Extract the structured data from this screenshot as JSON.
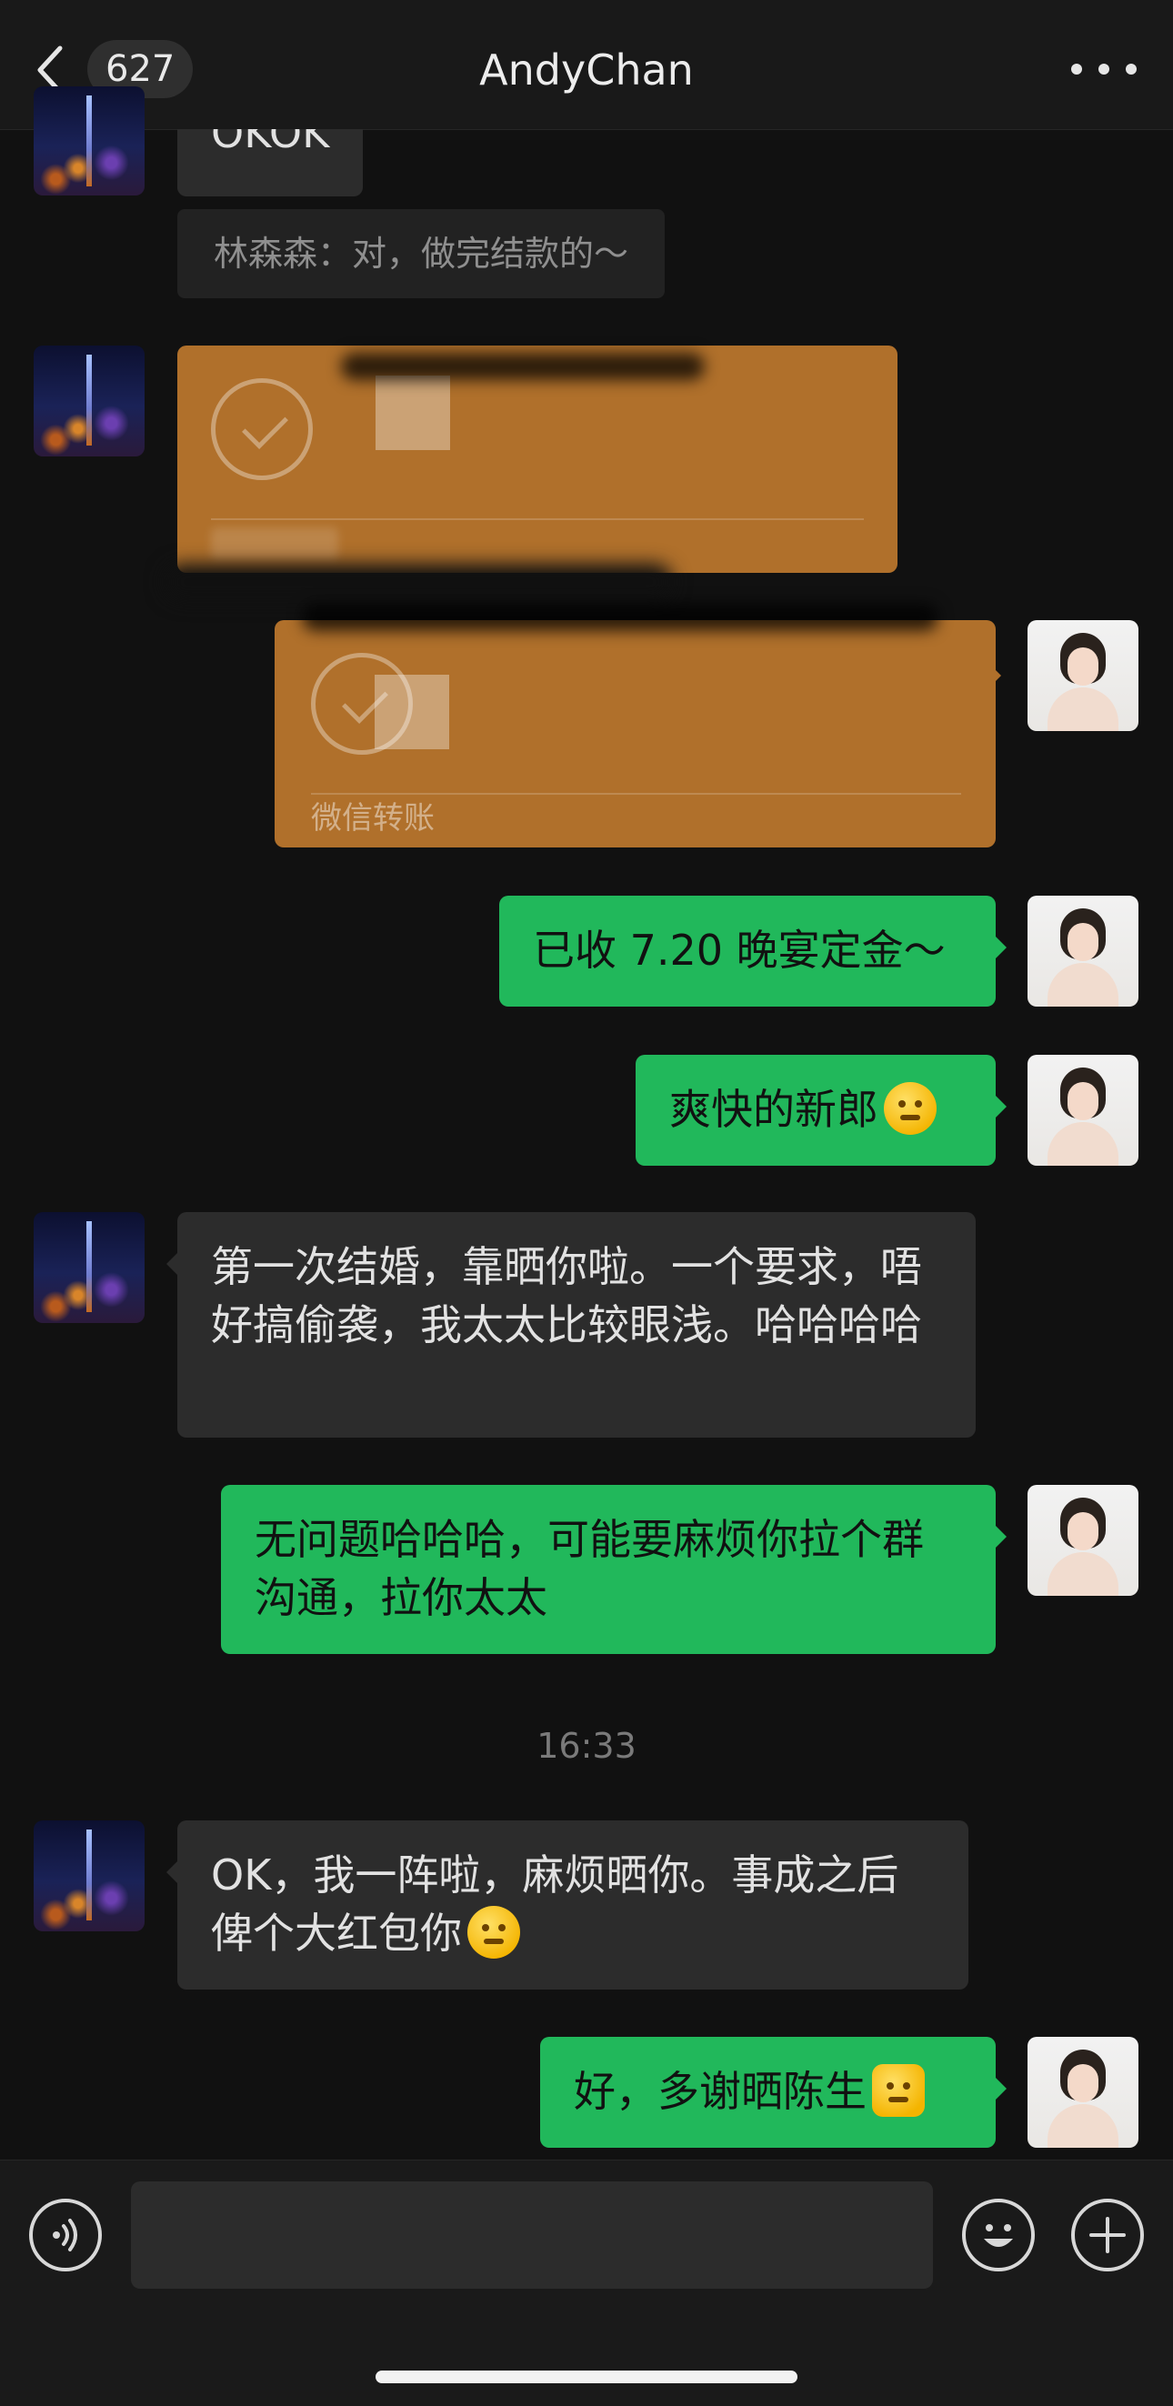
{
  "header": {
    "unread_count": "627",
    "title": "AndyChan"
  },
  "messages": {
    "top_partial": "OKOK",
    "quote": "林森森：对，做完结款的～",
    "transfer_caption": "微信转账",
    "out_1": "已收 7.20 晚宴定金～",
    "out_2": "爽快的新郎",
    "in_1": "第一次结婚，靠晒你啦。一个要求，唔好搞偷袭，我太太比较眼浅。哈哈哈哈",
    "out_3": "无问题哈哈哈，可能要麻烦你拉个群沟通，拉你太太",
    "timestamp": "16:33",
    "in_2": "OK，我一阵啦，麻烦晒你。事成之后俾个大红包你",
    "out_4": "好，多谢晒陈生"
  },
  "colors": {
    "background": "#111111",
    "incoming_bubble": "#2c2c2c",
    "outgoing_bubble": "#21b85b",
    "transfer_card": "#b0702b"
  },
  "icons": [
    "chevron-left-icon",
    "more-icon",
    "voice-icon",
    "emoji-icon",
    "plus-icon"
  ]
}
